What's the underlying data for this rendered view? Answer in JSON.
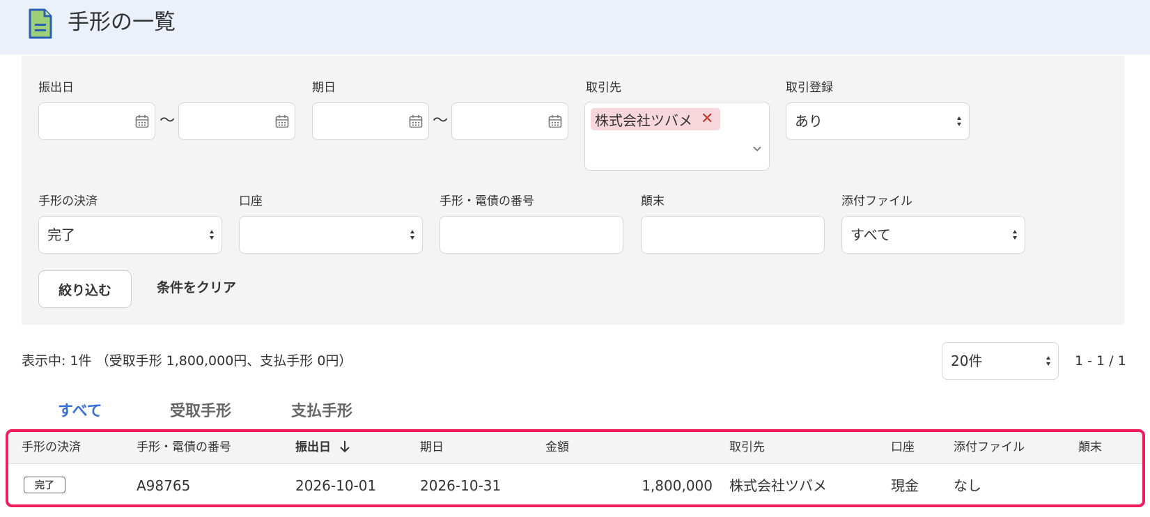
{
  "page": {
    "title": "手形の一覧"
  },
  "filters": {
    "issue_date_label": "振出日",
    "issue_date_from": "",
    "issue_date_to": "",
    "tilde": "〜",
    "due_date_label": "期日",
    "due_date_from": "",
    "due_date_to": "",
    "partner_label": "取引先",
    "partner_tag": "株式会社ツバメ",
    "partner_tag_remove": "✕",
    "trade_registration_label": "取引登録",
    "trade_registration_value": "あり",
    "settlement_label": "手形の決済",
    "settlement_value": "完了",
    "account_label": "口座",
    "account_value": "",
    "number_label": "手形・電債の番号",
    "number_value": "",
    "summary_label": "顛末",
    "summary_value": "",
    "attachment_label": "添付ファイル",
    "attachment_value": "すべて",
    "apply_button": "絞り込む",
    "clear_button": "条件をクリア"
  },
  "results": {
    "summary_text": "表示中: 1件 （受取手形 1,800,000円、支払手形 0円）",
    "per_page": "20件",
    "range": "1 - 1 / 1"
  },
  "tabs": [
    {
      "label": "すべて",
      "active": true
    },
    {
      "label": "受取手形",
      "active": false
    },
    {
      "label": "支払手形",
      "active": false
    }
  ],
  "table": {
    "columns": [
      "手形の決済",
      "手形・電債の番号",
      "振出日",
      "期日",
      "金額",
      "取引先",
      "口座",
      "添付ファイル",
      "顛末"
    ],
    "sorted_column": "振出日",
    "rows": [
      {
        "status": "完了",
        "number": "A98765",
        "issue_date": "2026-10-01",
        "due_date": "2026-10-31",
        "amount": "1,800,000",
        "partner": "株式会社ツバメ",
        "account": "現金",
        "attachment": "なし",
        "summary": ""
      }
    ]
  },
  "colors": {
    "header_bg": "#eaf1fb",
    "panel_bg": "#f5f4f4",
    "active_tab": "#3b6fd8",
    "highlight_border": "#ee1d5e",
    "tag_bg": "#f8d7dc",
    "icon_green": "#9ed07a",
    "icon_blue": "#2b5fb4"
  }
}
